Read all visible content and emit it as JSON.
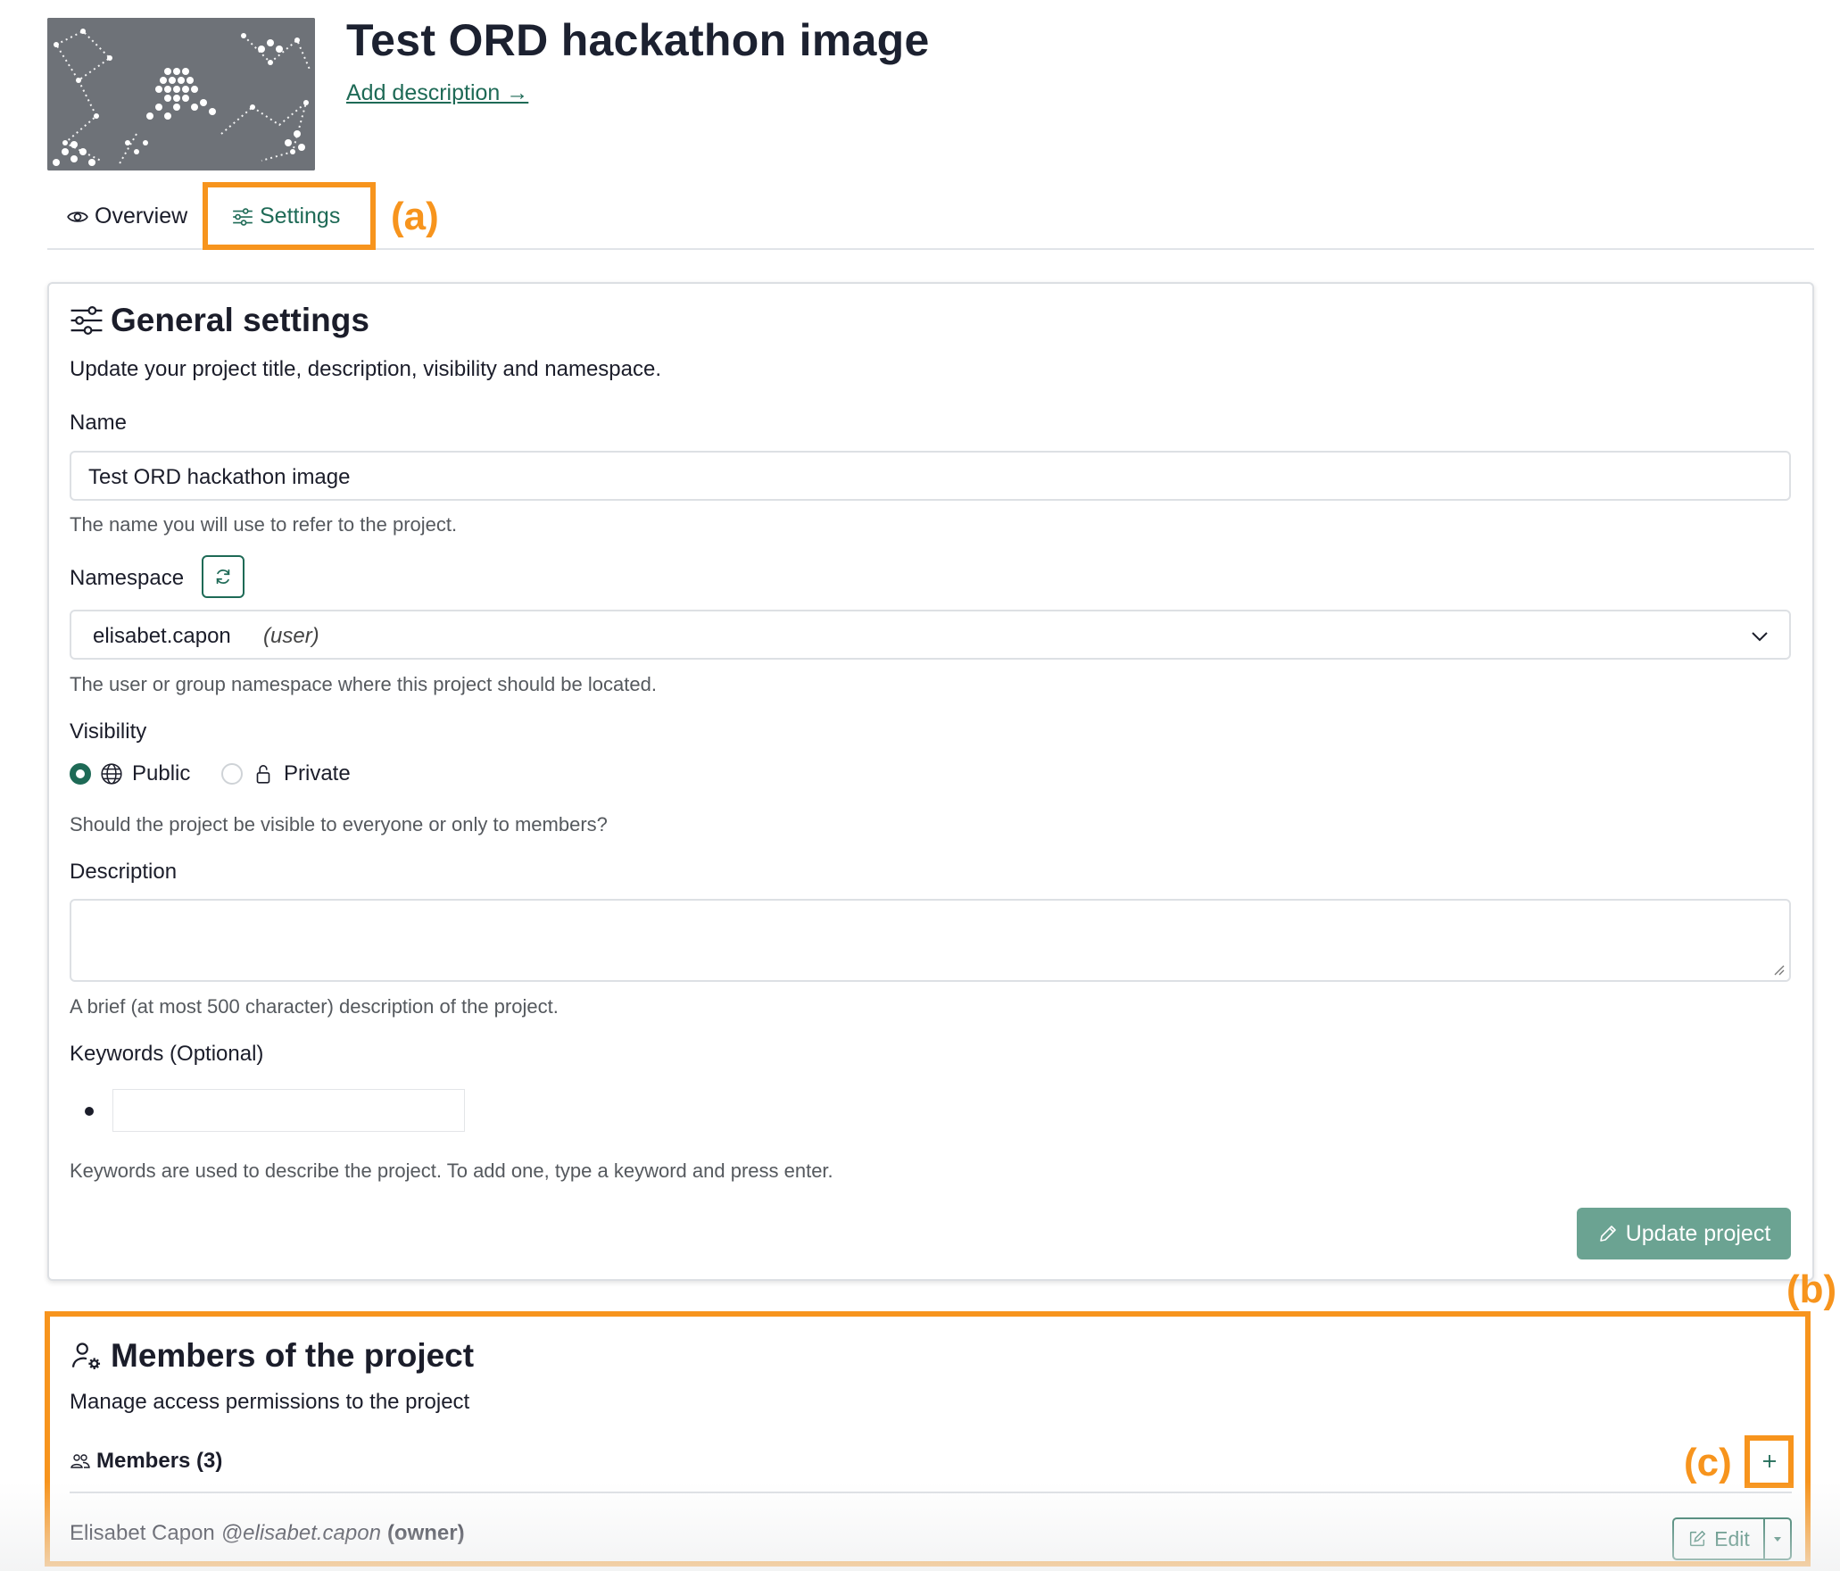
{
  "header": {
    "project_title": "Test ORD hackathon image",
    "add_description_label": "Add description →"
  },
  "tabs": [
    {
      "label": "Overview",
      "icon": "eye-icon"
    },
    {
      "label": "Settings",
      "icon": "sliders-icon"
    }
  ],
  "annotations": {
    "a": "(a)",
    "b": "(b)",
    "c": "(c)",
    "color": "#f7941d"
  },
  "general_settings": {
    "title": "General settings",
    "subtitle": "Update your project title, description, visibility and namespace.",
    "name": {
      "label": "Name",
      "value": "Test ORD hackathon image",
      "help": "The name you will use to refer to the project."
    },
    "namespace": {
      "label": "Namespace",
      "value": "elisabet.capon",
      "kind": "(user)",
      "help": "The user or group namespace where this project should be located."
    },
    "visibility": {
      "label": "Visibility",
      "options": [
        {
          "label": "Public",
          "icon": "globe-icon",
          "selected": true
        },
        {
          "label": "Private",
          "icon": "lock-icon",
          "selected": false
        }
      ],
      "help": "Should the project be visible to everyone or only to members?"
    },
    "description": {
      "label": "Description",
      "value": "",
      "help": "A brief (at most 500 character) description of the project."
    },
    "keywords": {
      "label": "Keywords (Optional)",
      "value": "",
      "help": "Keywords are used to describe the project. To add one, type a keyword and press enter."
    },
    "update_button_label": "Update project"
  },
  "members": {
    "title": "Members of the project",
    "subtitle": "Manage access permissions to the project",
    "count_label": "Members (3)",
    "list": [
      {
        "name": "Elisabet Capon",
        "handle": "@elisabet.capon",
        "role": "(owner)"
      }
    ],
    "edit_label": "Edit"
  },
  "colors": {
    "accent": "#1e6a56",
    "button_bg": "#6ba392",
    "annotation": "#f7941d"
  }
}
